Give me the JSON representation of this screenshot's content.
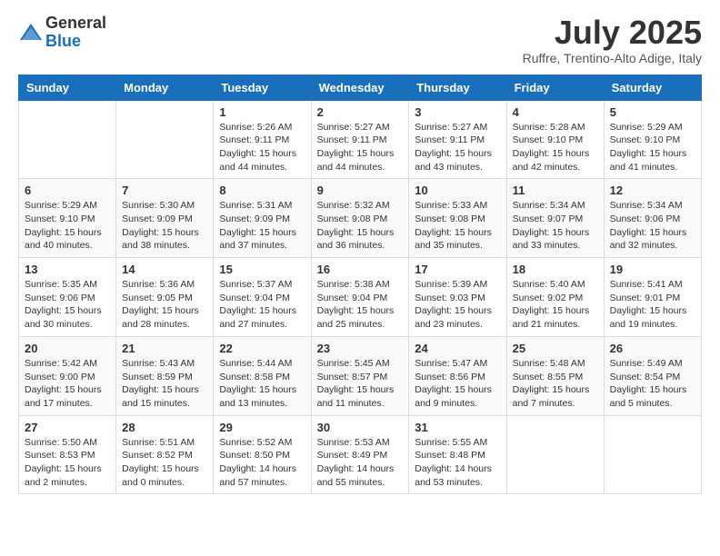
{
  "header": {
    "logo_general": "General",
    "logo_blue": "Blue",
    "month_title": "July 2025",
    "location": "Ruffre, Trentino-Alto Adige, Italy"
  },
  "days_of_week": [
    "Sunday",
    "Monday",
    "Tuesday",
    "Wednesday",
    "Thursday",
    "Friday",
    "Saturday"
  ],
  "weeks": [
    [
      {
        "day": "",
        "info": ""
      },
      {
        "day": "",
        "info": ""
      },
      {
        "day": "1",
        "info": "Sunrise: 5:26 AM\nSunset: 9:11 PM\nDaylight: 15 hours and 44 minutes."
      },
      {
        "day": "2",
        "info": "Sunrise: 5:27 AM\nSunset: 9:11 PM\nDaylight: 15 hours and 44 minutes."
      },
      {
        "day": "3",
        "info": "Sunrise: 5:27 AM\nSunset: 9:11 PM\nDaylight: 15 hours and 43 minutes."
      },
      {
        "day": "4",
        "info": "Sunrise: 5:28 AM\nSunset: 9:10 PM\nDaylight: 15 hours and 42 minutes."
      },
      {
        "day": "5",
        "info": "Sunrise: 5:29 AM\nSunset: 9:10 PM\nDaylight: 15 hours and 41 minutes."
      }
    ],
    [
      {
        "day": "6",
        "info": "Sunrise: 5:29 AM\nSunset: 9:10 PM\nDaylight: 15 hours and 40 minutes."
      },
      {
        "day": "7",
        "info": "Sunrise: 5:30 AM\nSunset: 9:09 PM\nDaylight: 15 hours and 38 minutes."
      },
      {
        "day": "8",
        "info": "Sunrise: 5:31 AM\nSunset: 9:09 PM\nDaylight: 15 hours and 37 minutes."
      },
      {
        "day": "9",
        "info": "Sunrise: 5:32 AM\nSunset: 9:08 PM\nDaylight: 15 hours and 36 minutes."
      },
      {
        "day": "10",
        "info": "Sunrise: 5:33 AM\nSunset: 9:08 PM\nDaylight: 15 hours and 35 minutes."
      },
      {
        "day": "11",
        "info": "Sunrise: 5:34 AM\nSunset: 9:07 PM\nDaylight: 15 hours and 33 minutes."
      },
      {
        "day": "12",
        "info": "Sunrise: 5:34 AM\nSunset: 9:06 PM\nDaylight: 15 hours and 32 minutes."
      }
    ],
    [
      {
        "day": "13",
        "info": "Sunrise: 5:35 AM\nSunset: 9:06 PM\nDaylight: 15 hours and 30 minutes."
      },
      {
        "day": "14",
        "info": "Sunrise: 5:36 AM\nSunset: 9:05 PM\nDaylight: 15 hours and 28 minutes."
      },
      {
        "day": "15",
        "info": "Sunrise: 5:37 AM\nSunset: 9:04 PM\nDaylight: 15 hours and 27 minutes."
      },
      {
        "day": "16",
        "info": "Sunrise: 5:38 AM\nSunset: 9:04 PM\nDaylight: 15 hours and 25 minutes."
      },
      {
        "day": "17",
        "info": "Sunrise: 5:39 AM\nSunset: 9:03 PM\nDaylight: 15 hours and 23 minutes."
      },
      {
        "day": "18",
        "info": "Sunrise: 5:40 AM\nSunset: 9:02 PM\nDaylight: 15 hours and 21 minutes."
      },
      {
        "day": "19",
        "info": "Sunrise: 5:41 AM\nSunset: 9:01 PM\nDaylight: 15 hours and 19 minutes."
      }
    ],
    [
      {
        "day": "20",
        "info": "Sunrise: 5:42 AM\nSunset: 9:00 PM\nDaylight: 15 hours and 17 minutes."
      },
      {
        "day": "21",
        "info": "Sunrise: 5:43 AM\nSunset: 8:59 PM\nDaylight: 15 hours and 15 minutes."
      },
      {
        "day": "22",
        "info": "Sunrise: 5:44 AM\nSunset: 8:58 PM\nDaylight: 15 hours and 13 minutes."
      },
      {
        "day": "23",
        "info": "Sunrise: 5:45 AM\nSunset: 8:57 PM\nDaylight: 15 hours and 11 minutes."
      },
      {
        "day": "24",
        "info": "Sunrise: 5:47 AM\nSunset: 8:56 PM\nDaylight: 15 hours and 9 minutes."
      },
      {
        "day": "25",
        "info": "Sunrise: 5:48 AM\nSunset: 8:55 PM\nDaylight: 15 hours and 7 minutes."
      },
      {
        "day": "26",
        "info": "Sunrise: 5:49 AM\nSunset: 8:54 PM\nDaylight: 15 hours and 5 minutes."
      }
    ],
    [
      {
        "day": "27",
        "info": "Sunrise: 5:50 AM\nSunset: 8:53 PM\nDaylight: 15 hours and 2 minutes."
      },
      {
        "day": "28",
        "info": "Sunrise: 5:51 AM\nSunset: 8:52 PM\nDaylight: 15 hours and 0 minutes."
      },
      {
        "day": "29",
        "info": "Sunrise: 5:52 AM\nSunset: 8:50 PM\nDaylight: 14 hours and 57 minutes."
      },
      {
        "day": "30",
        "info": "Sunrise: 5:53 AM\nSunset: 8:49 PM\nDaylight: 14 hours and 55 minutes."
      },
      {
        "day": "31",
        "info": "Sunrise: 5:55 AM\nSunset: 8:48 PM\nDaylight: 14 hours and 53 minutes."
      },
      {
        "day": "",
        "info": ""
      },
      {
        "day": "",
        "info": ""
      }
    ]
  ]
}
